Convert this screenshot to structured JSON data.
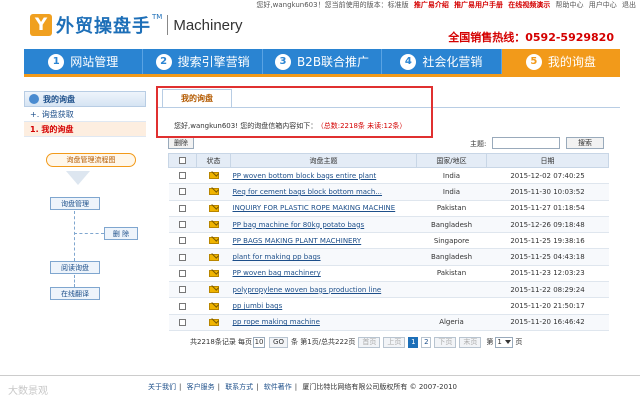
{
  "topbar": {
    "greeting": "您好,wangkun603！您当前使用的版本：标准版",
    "links": [
      "推广易介绍",
      "推广易用户手册",
      "在线视频演示",
      "帮助中心",
      "用户中心",
      "退出"
    ]
  },
  "brand": {
    "logo_mark": "Y",
    "name_cn": "外贸操盘手",
    "tm": "TM",
    "name_en": "Machinery"
  },
  "hotline": "全国销售热线：0592-5929820",
  "nav": [
    {
      "num": "1",
      "label": "网站管理"
    },
    {
      "num": "2",
      "label": "搜索引擎营销"
    },
    {
      "num": "3",
      "label": "B2B联合推广"
    },
    {
      "num": "4",
      "label": "社会化营销"
    },
    {
      "num": "5",
      "label": "我的询盘"
    }
  ],
  "sidebar": {
    "title": "我的询盘",
    "items": [
      "+. 询盘获取",
      "1. 我的询盘"
    ]
  },
  "flow": {
    "title": "询盘管理流程图",
    "manage": "询盘管理",
    "delete": "删 除",
    "read": "阅读询盘",
    "translate": "在线翻译"
  },
  "main": {
    "tab": "我的询盘",
    "greeting": "您好,wangkun603! 您的询盘信箱内容如下：",
    "stats": "（总数:2218条  未读:12条）",
    "delete_btn": "删除",
    "subject_label": "主题:",
    "search_btn": "搜索",
    "headers": [
      "",
      "状态",
      "询盘主题",
      "国家/地区",
      "日期"
    ],
    "rows": [
      {
        "subject": "PP woven bottom block bags entire plant",
        "country": "India",
        "date": "2015-12-02 07:40:25"
      },
      {
        "subject": "Req for cement bags block bottom mach...",
        "country": "India",
        "date": "2015-11-30 10:03:52"
      },
      {
        "subject": "INQUIRY FOR PLASTIC ROPE MAKING MACHINE",
        "country": "Pakistan",
        "date": "2015-11-27 01:18:54"
      },
      {
        "subject": "PP bag machine for 80kg potato bags",
        "country": "Bangladesh",
        "date": "2015-12-26 09:18:48"
      },
      {
        "subject": "PP BAGS MAKING PLANT MACHINERY",
        "country": "Singapore",
        "date": "2015-11-25 19:38:16"
      },
      {
        "subject": "plant for making pp bags",
        "country": "Bangladesh",
        "date": "2015-11-25 04:43:18"
      },
      {
        "subject": "PP woven bag machinery",
        "country": "Pakistan",
        "date": "2015-11-23 12:03:23"
      },
      {
        "subject": "polypropylene woven bags production line",
        "country": "",
        "date": "2015-11-22 08:29:24"
      },
      {
        "subject": "pp jumbi bags",
        "country": "",
        "date": "2015-11-20 21:50:17"
      },
      {
        "subject": "pp rope making machine",
        "country": "Algeria",
        "date": "2015-11-20 16:46:42"
      }
    ],
    "pager": {
      "total": "共2218条记录  每页",
      "per_page": "10",
      "go": "GO",
      "page_info": "条  第1页/总共222页",
      "first": "首页",
      "prev": "上页",
      "pages": [
        "1",
        "2"
      ],
      "next": "下页",
      "last": "末页",
      "goto_prefix": "第",
      "goto_value": "1",
      "goto_suffix": "页"
    }
  },
  "footer": {
    "links": [
      "关于我们",
      "客户服务",
      "联系方式",
      "软件著作"
    ],
    "copyright": "厦门比特比网络有限公司版权所有 © 2007-2010",
    "watermark": "大数景观"
  },
  "colors": {
    "brand_blue": "#2a84d2",
    "brand_orange": "#f29a1a",
    "alert_red": "#d40000"
  }
}
